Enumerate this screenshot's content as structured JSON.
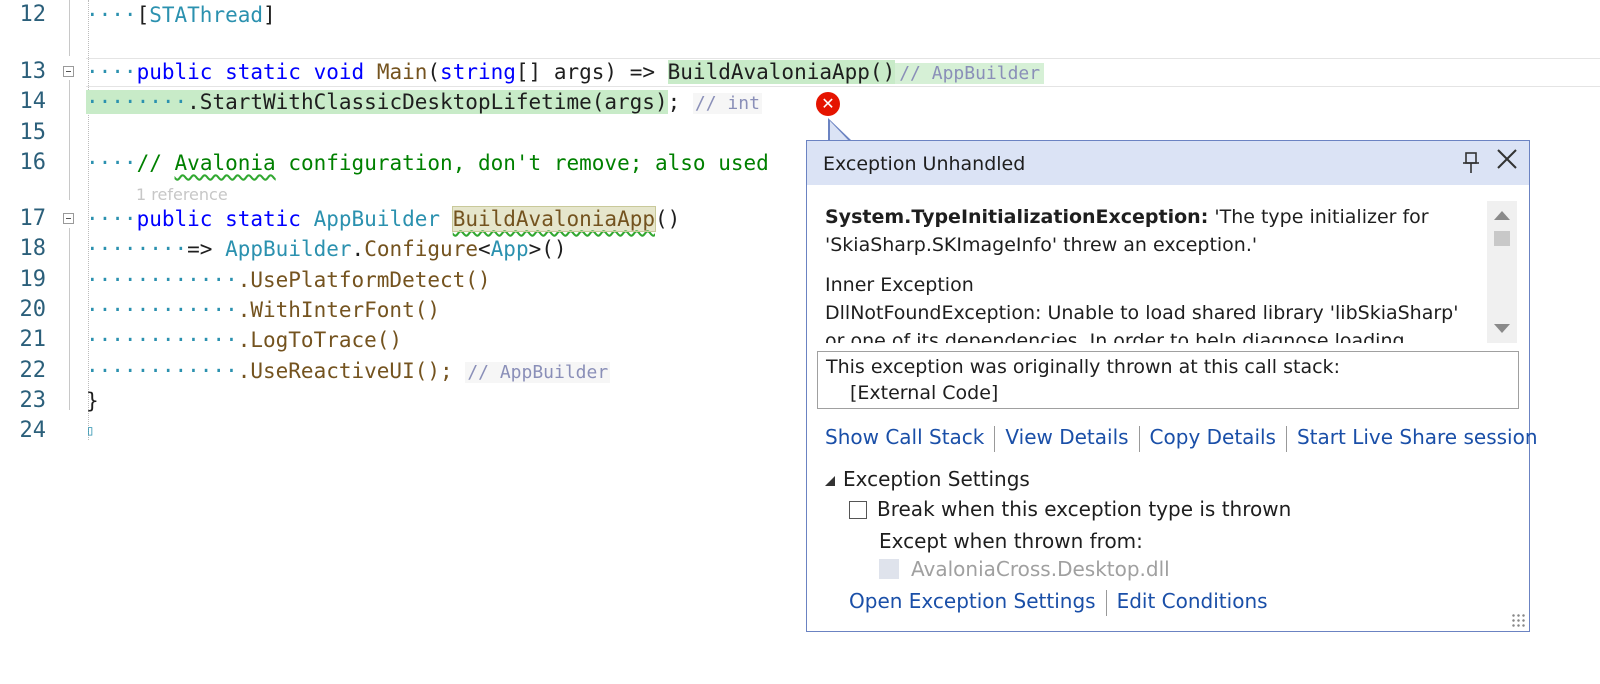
{
  "editor": {
    "lines": [
      {
        "num": "12"
      },
      {
        "num": "13"
      },
      {
        "num": "14"
      },
      {
        "num": "15"
      },
      {
        "num": "16"
      },
      {
        "num": "17"
      },
      {
        "num": "18"
      },
      {
        "num": "19"
      },
      {
        "num": "20"
      },
      {
        "num": "21"
      },
      {
        "num": "22"
      },
      {
        "num": "23"
      },
      {
        "num": "24"
      }
    ],
    "l12_attr": "STAThread",
    "l13_kw": "public static void",
    "l13_main": "Main",
    "l13_string": "string",
    "l13_args": "[] args) =>",
    "l13_build": "BuildAvaloniaApp()",
    "l13_hint": "// AppBuilder",
    "l14_code": ".StartWithClassicDesktopLifetime(args)",
    "l14_hint": "// int",
    "l16_comment_a": "//",
    "l16_avalonia": "Avalonia",
    "l16_comment_b": "configuration, don't remove; also used",
    "ref_hint": "1 reference",
    "l17_kw": "public static",
    "l17_type": "AppBuilder",
    "l17_method": "BuildAvaloniaApp",
    "l18_arrow": "=>",
    "l18_type": "AppBuilder",
    "l18_configure": "Configure",
    "l18_app": "App",
    "l19_call": ".UsePlatformDetect()",
    "l20_call": ".WithInterFont()",
    "l21_call": ".LogToTrace()",
    "l22_call": ".UseReactiveUI();",
    "l22_hint": "// AppBuilder",
    "l23_brace": "}"
  },
  "popup": {
    "title": "Exception Unhandled",
    "pin_icon": "pin-icon",
    "close_icon": "close-icon",
    "exception_type": "System.TypeInitializationException:",
    "exception_msg": "'The type initializer for 'SkiaSharp.SKImageInfo' threw an exception.'",
    "inner_label": "Inner Exception",
    "inner_msg": "DllNotFoundException: Unable to load shared library 'libSkiaSharp' or one of its dependencies. In order to help diagnose loading problems",
    "stack_header": "This exception was originally thrown at this call stack:",
    "stack_frame": "[External Code]",
    "links": {
      "show_call_stack": "Show Call Stack",
      "view_details": "View Details",
      "copy_details": "Copy Details",
      "live_share": "Start Live Share session"
    },
    "settings_header": "Exception Settings",
    "break_label": "Break when this exception type is thrown",
    "break_checked": false,
    "except_label": "Except when thrown from:",
    "dll_label": "AvaloniaCross.Desktop.dll",
    "open_settings": "Open Exception Settings",
    "edit_conditions": "Edit Conditions"
  }
}
